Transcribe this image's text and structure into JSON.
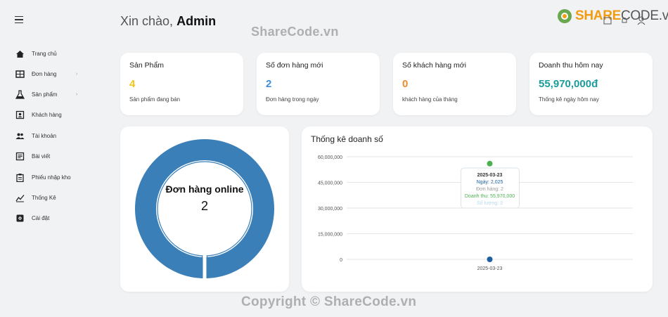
{
  "header": {
    "greeting": "Xin chào,",
    "user": "Admin"
  },
  "logo": {
    "share": "SHARE",
    "code": "CODE",
    "vn": ".vn"
  },
  "watermark": {
    "top": "ShareCode.vn",
    "bottom": "Copyright © ShareCode.vn"
  },
  "sidebar": {
    "items": [
      {
        "label": "Trang chủ",
        "icon": "home-icon",
        "chevron": false
      },
      {
        "label": "Đơn hàng",
        "icon": "table-icon",
        "chevron": true
      },
      {
        "label": "Sản phẩm",
        "icon": "flask-icon",
        "chevron": true
      },
      {
        "label": "Khách hàng",
        "icon": "contact-icon",
        "chevron": false
      },
      {
        "label": "Tài khoản",
        "icon": "people-icon",
        "chevron": false
      },
      {
        "label": "Bài viết",
        "icon": "article-icon",
        "chevron": false
      },
      {
        "label": "Phiếu nhập kho",
        "icon": "clipboard-icon",
        "chevron": false
      },
      {
        "label": "Thống Kê",
        "icon": "chart-line-icon",
        "chevron": false
      },
      {
        "label": "Cài đặt",
        "icon": "settings-icon",
        "chevron": false
      }
    ]
  },
  "stats": [
    {
      "title": "Sản Phẩm",
      "value": "4",
      "sub": "Sản phẩm đang bán",
      "color": "#f5c518"
    },
    {
      "title": "Số đơn hàng mới",
      "value": "2",
      "sub": "Đơn hàng trong ngày",
      "color": "#3a8fd8"
    },
    {
      "title": "Số khách hàng mới",
      "value": "0",
      "sub": "khách hàng của tháng",
      "color": "#ef8a2f"
    },
    {
      "title": "Doanh thu hôm nay",
      "value": "55,970,000đ",
      "sub": "Thống kê ngày hôm nay",
      "color": "#1a9c9c"
    }
  ],
  "donut": {
    "label": "Đơn hàng online",
    "value": "2",
    "color": "#3a7fb8"
  },
  "chart_data": {
    "type": "scatter",
    "title": "Thống kê doanh số",
    "x": [
      "2025-03-23"
    ],
    "ylim": [
      0,
      60000000
    ],
    "yticks": [
      "0",
      "15,000,000",
      "30,000,000",
      "45,000,000",
      "60,000,000"
    ],
    "series": [
      {
        "values": [
          55970000
        ],
        "color": "#4caf50"
      },
      {
        "values": [
          0
        ],
        "color": "#1d5fa0"
      }
    ],
    "tooltip": {
      "date": "2025-03-23",
      "lines": [
        {
          "text": "Ngày: 2,025",
          "color": "#1d5fa0"
        },
        {
          "text": "Đơn hàng: 2",
          "color": "#999999"
        },
        {
          "text": "Doanh thu: 55,970,000",
          "color": "#4caf50"
        },
        {
          "text": "Số lượng: 3",
          "color": "#b5d8ee"
        }
      ]
    }
  }
}
